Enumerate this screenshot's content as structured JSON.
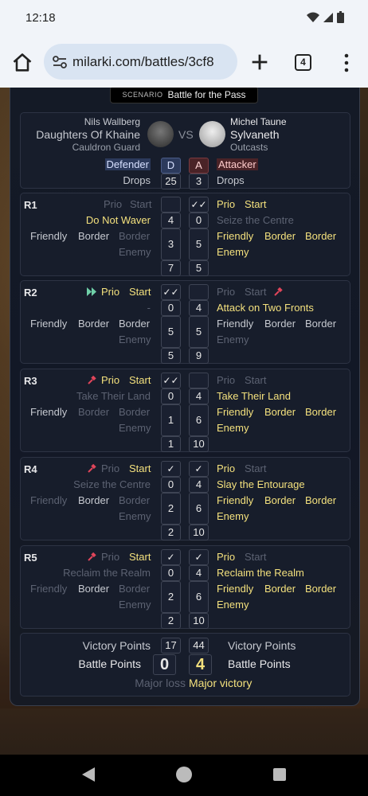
{
  "status": {
    "time": "12:18"
  },
  "browser": {
    "url": "milarki.com/battles/3cf8",
    "tab_count": "4"
  },
  "scenario": {
    "label": "SCENARIO",
    "name": "Battle for the Pass"
  },
  "players": {
    "left": {
      "name": "Nils Wallberg",
      "faction": "Daughters Of Khaine",
      "subfaction": "Cauldron Guard"
    },
    "vs": "VS",
    "right": {
      "name": "Michel Taune",
      "faction": "Sylvaneth",
      "subfaction": "Outcasts"
    },
    "left_role": "Defender",
    "left_role_code": "D",
    "right_role_code": "A",
    "right_role": "Attacker",
    "drops_label": "Drops",
    "left_drops": "25",
    "right_drops": "3"
  },
  "labels": {
    "prio": "Prio",
    "start": "Start",
    "friendly": "Friendly",
    "border": "Border",
    "enemy": "Enemy",
    "check_double": "✓✓",
    "check": "✓"
  },
  "rounds": [
    {
      "label": "R1",
      "left_tactic": "Do Not Waver",
      "right_tactic": "Seize the Centre",
      "left_tactic_score": "4",
      "right_tactic_score": "0",
      "left_obj_score": "3",
      "right_obj_score": "5",
      "left_total": "7",
      "right_total": "5"
    },
    {
      "label": "R2",
      "left_tactic": "-",
      "right_tactic": "Attack on Two Fronts",
      "left_tactic_score": "0",
      "right_tactic_score": "4",
      "left_obj_score": "5",
      "right_obj_score": "5",
      "left_total": "5",
      "right_total": "9"
    },
    {
      "label": "R3",
      "left_tactic": "Take Their Land",
      "right_tactic": "Take Their Land",
      "left_tactic_score": "0",
      "right_tactic_score": "4",
      "left_obj_score": "1",
      "right_obj_score": "6",
      "left_total": "1",
      "right_total": "10"
    },
    {
      "label": "R4",
      "left_tactic": "Seize the Centre",
      "right_tactic": "Slay the Entourage",
      "left_tactic_score": "0",
      "right_tactic_score": "4",
      "left_obj_score": "2",
      "right_obj_score": "6",
      "left_total": "2",
      "right_total": "10"
    },
    {
      "label": "R5",
      "left_tactic": "Reclaim the Realm",
      "right_tactic": "Reclaim the Realm",
      "left_tactic_score": "0",
      "right_tactic_score": "4",
      "left_obj_score": "2",
      "right_obj_score": "6",
      "left_total": "2",
      "right_total": "10"
    }
  ],
  "summary": {
    "vp_label": "Victory Points",
    "left_vp": "17",
    "right_vp": "44",
    "bp_label": "Battle Points",
    "left_bp": "0",
    "right_bp": "4",
    "left_result": "Major loss",
    "right_result": "Major victory"
  },
  "colors": {
    "gold": "#f3e07d",
    "defender": "#2c3a5c",
    "attacker": "#4a2327",
    "priority_red": "#e0455a",
    "priority_green": "#6fd0a8"
  }
}
